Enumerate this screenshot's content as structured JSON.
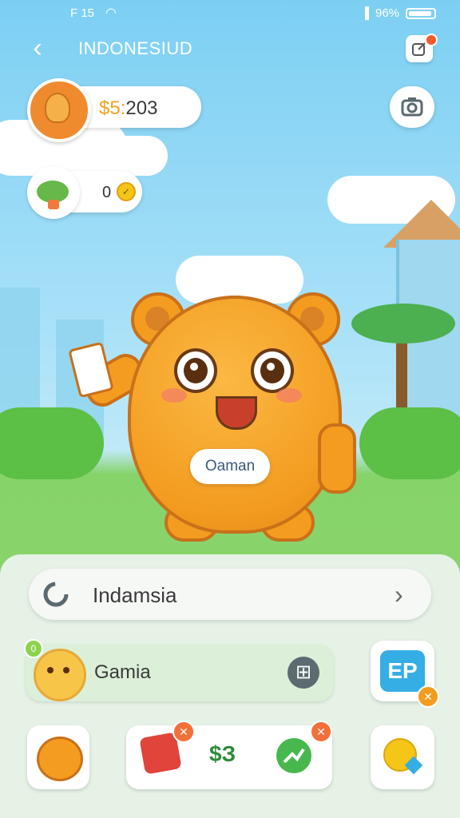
{
  "status_bar": {
    "time": "F 15",
    "battery_percent": "96%"
  },
  "header": {
    "title": "INDONESIUD"
  },
  "currency": {
    "coins_symbol": "$5:",
    "coins_value": "203",
    "gems_value": "0"
  },
  "mascot": {
    "label": "Oaman"
  },
  "panel": {
    "country_label": "Indamsia",
    "game_label": "Gamia",
    "game_badge": "0",
    "ep_label": "EP",
    "amount_label": "$З"
  }
}
